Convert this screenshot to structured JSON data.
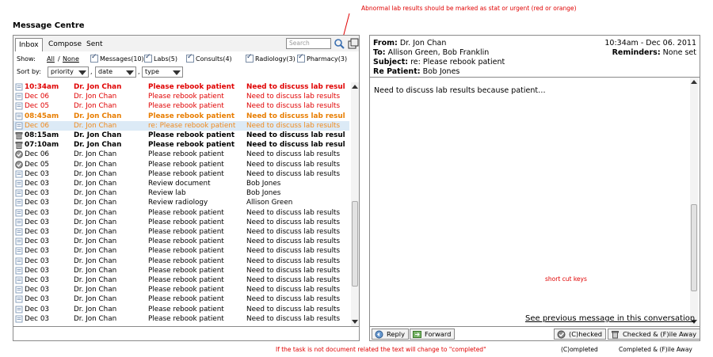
{
  "page_title": "Message Centre",
  "annotations": {
    "abnormal": "Abnormal lab results should be marked as stat or urgent (red or orange)",
    "shortcut": "short cut keys",
    "completed_note": "If the task is not document related the text will change to \"completed\"",
    "completed_label": "(C)ompleted",
    "completed_file_label": "Completed & (F)ile Away"
  },
  "tabs": [
    "Inbox",
    "Compose",
    "Sent"
  ],
  "search_placeholder": "Search",
  "filter": {
    "show_label": "Show:",
    "all": "All",
    "sep": "/",
    "none": "None",
    "items": [
      "Messages(10)",
      "Labs(5)",
      "Consults(4)",
      "Radiology(3)",
      "Pharmacy(3)"
    ]
  },
  "sort": {
    "label": "Sort by:",
    "options": [
      "priority",
      "date",
      "type"
    ],
    "comma": ","
  },
  "messages": [
    {
      "icon": "doc",
      "time": "10:34am",
      "from": "Dr. Jon Chan",
      "subject": "Please rebook patient",
      "preview": "Need to discuss lab resul",
      "style": "red bold"
    },
    {
      "icon": "doc",
      "time": "Dec 06",
      "from": "Dr. Jon Chan",
      "subject": "Please rebook patient",
      "preview": "Need to discuss lab results",
      "style": "red"
    },
    {
      "icon": "doc",
      "time": "Dec 05",
      "from": "Dr. Jon Chan",
      "subject": "Please rebook patient",
      "preview": "Need to discuss lab results",
      "style": "red"
    },
    {
      "icon": "doc",
      "time": "08:45am",
      "from": "Dr. Jon Chan",
      "subject": "Please rebook patient",
      "preview": "Need to discuss lab resul",
      "style": "orange bold"
    },
    {
      "icon": "doc",
      "time": "Dec 06",
      "from": "Dr. Jon Chan",
      "subject": "re: Please rebook patient",
      "preview": "Need to discuss lab results",
      "style": "sel-row"
    },
    {
      "icon": "trash",
      "time": "08:15am",
      "from": "Dr. Jon Chan",
      "subject": "Please rebook patient",
      "preview": "Need to discuss lab resul",
      "style": "bold"
    },
    {
      "icon": "trash",
      "time": "07:10am",
      "from": "Dr. Jon Chan",
      "subject": "Please rebook patient",
      "preview": "Need to discuss lab resul",
      "style": "bold"
    },
    {
      "icon": "check",
      "time": "Dec 06",
      "from": "Dr. Jon Chan",
      "subject": "Please rebook patient",
      "preview": "Need to discuss lab results",
      "style": ""
    },
    {
      "icon": "check",
      "time": "Dec 05",
      "from": "Dr. Jon Chan",
      "subject": "Please rebook patient",
      "preview": "Need to discuss lab results",
      "style": ""
    },
    {
      "icon": "doc",
      "time": "Dec 03",
      "from": "Dr. Jon Chan",
      "subject": "Please rebook patient",
      "preview": "Need to discuss lab results",
      "style": ""
    },
    {
      "icon": "doc",
      "time": "Dec 03",
      "from": "Dr. Jon Chan",
      "subject": "Review document",
      "preview": "Bob Jones",
      "style": ""
    },
    {
      "icon": "doc",
      "time": "Dec 03",
      "from": "Dr. Jon Chan",
      "subject": "Review lab",
      "preview": "Bob Jones",
      "style": ""
    },
    {
      "icon": "doc",
      "time": "Dec 03",
      "from": "Dr. Jon Chan",
      "subject": "Review radiology",
      "preview": "Allison Green",
      "style": ""
    },
    {
      "icon": "doc",
      "time": "Dec 03",
      "from": "Dr. Jon Chan",
      "subject": "Please rebook patient",
      "preview": "Need to discuss lab results",
      "style": ""
    },
    {
      "icon": "doc",
      "time": "Dec 03",
      "from": "Dr. Jon Chan",
      "subject": "Please rebook patient",
      "preview": "Need to discuss lab results",
      "style": ""
    },
    {
      "icon": "doc",
      "time": "Dec 03",
      "from": "Dr. Jon Chan",
      "subject": "Please rebook patient",
      "preview": "Need to discuss lab results",
      "style": ""
    },
    {
      "icon": "doc",
      "time": "Dec 03",
      "from": "Dr. Jon Chan",
      "subject": "Please rebook patient",
      "preview": "Need to discuss lab results",
      "style": ""
    },
    {
      "icon": "doc",
      "time": "Dec 03",
      "from": "Dr. Jon Chan",
      "subject": "Please rebook patient",
      "preview": "Need to discuss lab results",
      "style": ""
    },
    {
      "icon": "doc",
      "time": "Dec 03",
      "from": "Dr. Jon Chan",
      "subject": "Please rebook patient",
      "preview": "Need to discuss lab results",
      "style": ""
    },
    {
      "icon": "doc",
      "time": "Dec 03",
      "from": "Dr. Jon Chan",
      "subject": "Please rebook patient",
      "preview": "Need to discuss lab results",
      "style": ""
    },
    {
      "icon": "doc",
      "time": "Dec 03",
      "from": "Dr. Jon Chan",
      "subject": "Please rebook patient",
      "preview": "Need to discuss lab results",
      "style": ""
    },
    {
      "icon": "doc",
      "time": "Dec 03",
      "from": "Dr. Jon Chan",
      "subject": "Please rebook patient",
      "preview": "Need to discuss lab results",
      "style": ""
    },
    {
      "icon": "doc",
      "time": "Dec 03",
      "from": "Dr. Jon Chan",
      "subject": "Please rebook patient",
      "preview": "Need to discuss lab results",
      "style": ""
    },
    {
      "icon": "doc",
      "time": "Dec 03",
      "from": "Dr. Jon Chan",
      "subject": "Please rebook patient",
      "preview": "Need to discuss lab results",
      "style": ""
    },
    {
      "icon": "doc",
      "time": "Dec 03",
      "from": "Dr. Jon Chan",
      "subject": "Please rebook patient",
      "preview": "Need to discuss lab results",
      "style": ""
    }
  ],
  "detail": {
    "from_label": "From:",
    "from": "Dr. Jon Chan",
    "to_label": "To:",
    "to": "Allison Green, Bob Franklin",
    "subject_label": "Subject:",
    "subject": "re: Please rebook patient",
    "re_patient_label": "Re Patient:",
    "re_patient": "Bob Jones",
    "datetime": "10:34am - Dec 06. 2011",
    "reminders_label": "Reminders:",
    "reminders": "None set",
    "body": "Need to discuss lab results because patient…",
    "prev_link": "See previous message in this conversation"
  },
  "buttons": {
    "reply": "Reply",
    "forward": "Forward",
    "checked": "(C)hecked",
    "checked_file": "Checked & (F)ile Away"
  },
  "colors": {
    "urgent": "#e00000",
    "stat": "#e87d00",
    "selected_bg": "#dceaf6"
  }
}
